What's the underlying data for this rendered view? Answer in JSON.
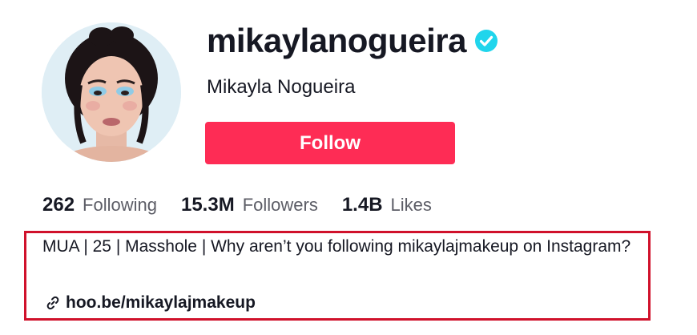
{
  "profile": {
    "username": "mikaylanogueira",
    "display_name": "Mikayla Nogueira",
    "verified": true,
    "follow_label": "Follow"
  },
  "stats": [
    {
      "value": "262",
      "label": "Following"
    },
    {
      "value": "15.3M",
      "label": "Followers"
    },
    {
      "value": "1.4B",
      "label": "Likes"
    }
  ],
  "bio": {
    "text": "MUA | 25 | Masshole | Why aren’t you following mikaylajmakeup on Instagram?",
    "link": "hoo.be/mikaylajmakeup"
  },
  "colors": {
    "accent": "#fe2c55",
    "verified_badge": "#20d5ec",
    "highlight_box": "#d0112b",
    "muted_text": "#5c5d66"
  },
  "icons": {
    "verified": "verified-check-icon",
    "link": "link-chain-icon"
  }
}
